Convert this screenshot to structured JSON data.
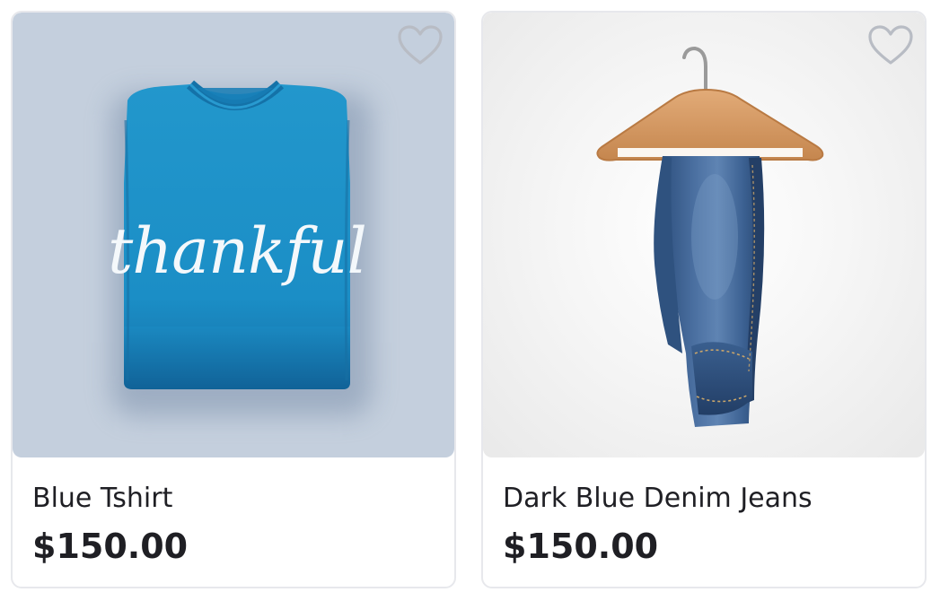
{
  "products": [
    {
      "name": "Blue Tshirt",
      "price": "$150.00",
      "image": "blue-folded-tshirt",
      "print_text": "thankful",
      "favorite": false,
      "shirt_color": "#1f92c9",
      "background": "#c4cfdd"
    },
    {
      "name": "Dark Blue Denim Jeans",
      "price": "$150.00",
      "image": "denim-jeans-on-hanger",
      "favorite": false,
      "denim_color": "#3a5f8f",
      "background": "#f2f2f2"
    }
  ],
  "favorite_icon": "heart-outline-icon",
  "colors": {
    "text": "#1f1f24",
    "border": "#e7e8ec",
    "heart_stroke": "#b8bcc4"
  }
}
